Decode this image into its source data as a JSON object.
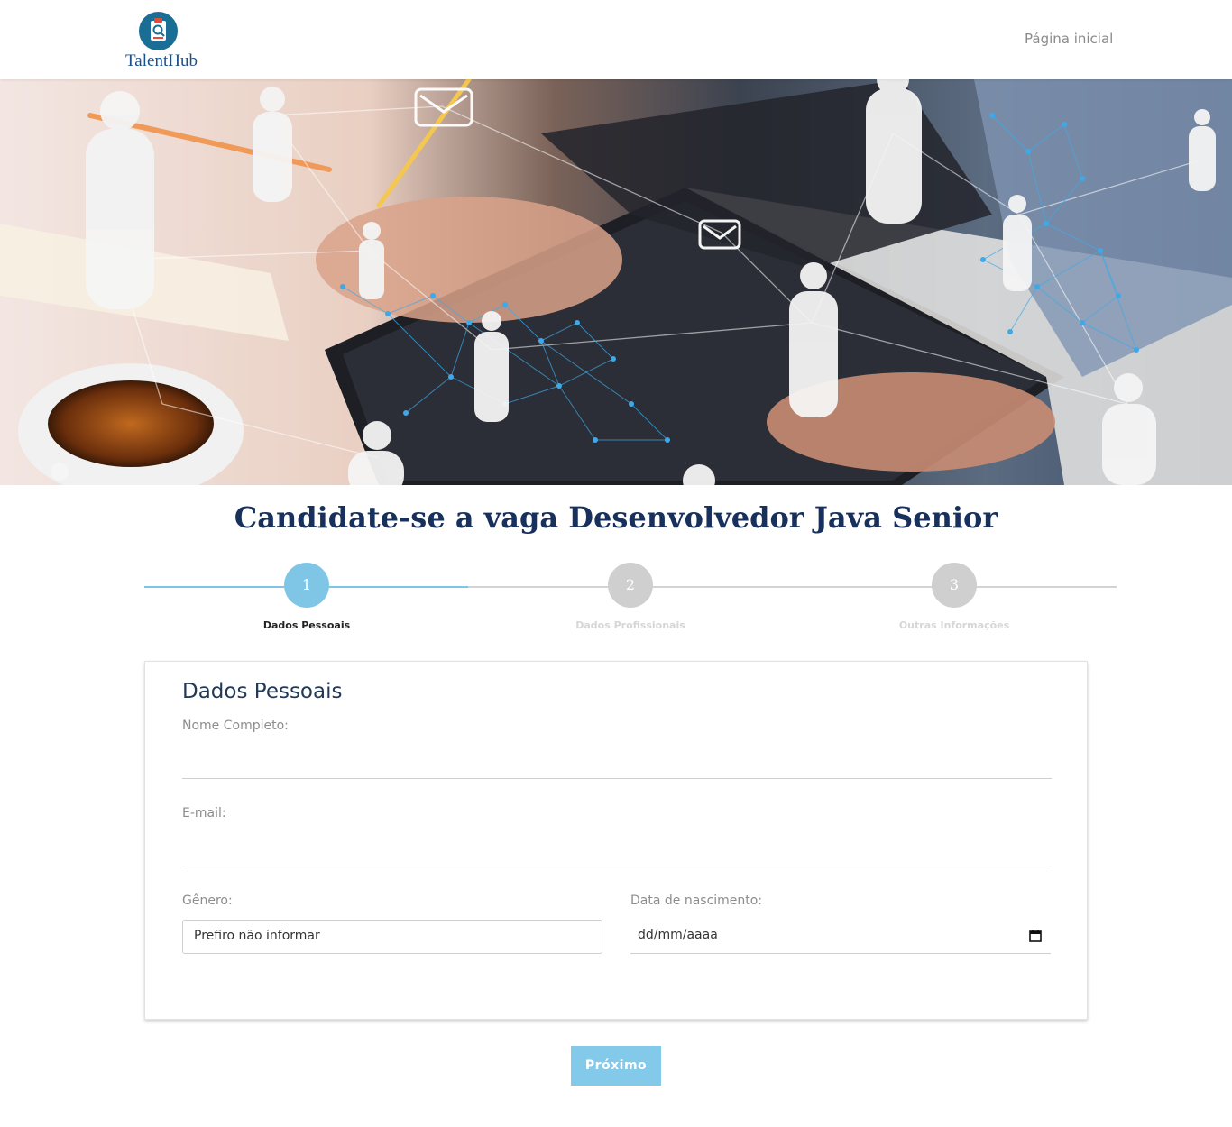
{
  "header": {
    "logo_text": "TalentHub",
    "nav_home": "Página inicial"
  },
  "page": {
    "title": "Candidate-se a vaga Desenvolvedor Java Senior"
  },
  "stepper": {
    "current_step": 1,
    "steps": [
      {
        "number": "1",
        "label": "Dados Pessoais"
      },
      {
        "number": "2",
        "label": "Dados Profissionais"
      },
      {
        "number": "3",
        "label": "Outras Informações"
      }
    ]
  },
  "form": {
    "section_title": "Dados Pessoais",
    "full_name_label": "Nome Completo:",
    "full_name_value": "",
    "email_label": "E-mail:",
    "email_value": "",
    "gender_label": "Gênero:",
    "gender_selected": "Prefiro não informar",
    "birthdate_label": "Data de nascimento:",
    "birthdate_placeholder": "dd/mm/aaaa"
  },
  "actions": {
    "next_label": "Próximo"
  },
  "colors": {
    "accent": "#83c9e9",
    "title": "#17305c",
    "inactive_step": "#cfcfcf"
  },
  "icons": {
    "logo": "clipboard-search-icon",
    "calendar": "calendar-icon"
  }
}
